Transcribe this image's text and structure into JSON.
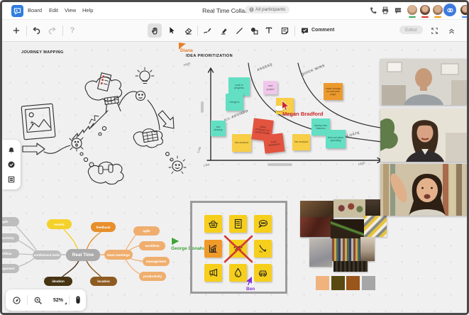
{
  "menubar": {
    "menus": [
      "Board",
      "Edit",
      "View",
      "Help"
    ],
    "title": "Real Time Collaboration",
    "participants_badge": "All participants",
    "action_icons": [
      "phone-icon",
      "printer-icon",
      "chat-icon",
      "invite-link-icon"
    ],
    "avatars": [
      {
        "underline": "#34a853"
      },
      {
        "underline": "#d93025"
      },
      {
        "underline": "#f29900"
      },
      {
        "underline": "#4285f4"
      }
    ]
  },
  "toolbar": {
    "left_tools": [
      "add",
      "undo",
      "redo",
      "help"
    ],
    "center_tools": [
      "hand",
      "select",
      "eraser",
      "pen",
      "highlighter",
      "line",
      "shapes",
      "text",
      "sticky-note",
      "comment"
    ],
    "selected_tool": "hand",
    "comment_label": "Comment",
    "role_badge": "Editor",
    "right_controls": [
      "fullscreen",
      "collapse-toolbar"
    ]
  },
  "canvas": {
    "journey_title": "JOURNEY MAPPING",
    "matrix": {
      "title": "IDEA PRIORITIZATION",
      "regions": {
        "assess": "ASSESS",
        "quick_wins": "QUICK WINS",
        "ill_advised": "ILL-ADVISED",
        "evaluate": "EVALUATE"
      },
      "axes": {
        "x_low": "Low",
        "x_high": "High",
        "y_low": "Low",
        "y_high": "High"
      },
      "notes": [
        {
          "text": "work in progress",
          "color": "#63dfc4"
        },
        {
          "text": "merge in",
          "color": "#63dfc4"
        },
        {
          "text": "new project",
          "color": "#f0c7eb"
        },
        {
          "text": "",
          "color": "#f7ce46"
        },
        {
          "text": "make change on welcome page",
          "color": "#ec9a2e"
        },
        {
          "text": "doc sharing",
          "color": "#63dfc4"
        },
        {
          "text": "risk analysis",
          "color": "#f7ce46"
        },
        {
          "text": "share privileges on social media",
          "color": "#e25440"
        },
        {
          "text": "team integration",
          "color": "#e25440"
        },
        {
          "text": "risk analysis",
          "color": "#f7ce46"
        },
        {
          "text": "deploy new features",
          "color": "#63dfc4"
        },
        {
          "text": "time out when operating",
          "color": "#63dfc4"
        }
      ],
      "edit_tooltip": "···"
    },
    "mindmap": {
      "center": {
        "label": "Real Time",
        "color": "#ababab"
      },
      "nodes": [
        {
          "label": "events",
          "color": "#f5d12b"
        },
        {
          "label": "feedback",
          "color": "#e78f2b"
        },
        {
          "label": "conference tools",
          "color": "#bdbdbd"
        },
        {
          "label": "team meetings",
          "color": "#efae6e"
        },
        {
          "label": "agile",
          "color": "#efae6e"
        },
        {
          "label": "workflow",
          "color": "#efae6e"
        },
        {
          "label": "management",
          "color": "#efae6e"
        },
        {
          "label": "productivity",
          "color": "#efae6e"
        },
        {
          "label": "ideation",
          "color": "#473413"
        },
        {
          "label": "location",
          "color": "#8d5b21"
        }
      ],
      "left_stubs": [
        {
          "label": "agile",
          "color": "#bdbdbd"
        },
        {
          "label": "productivity",
          "color": "#bdbdbd"
        },
        {
          "label": "workflow",
          "color": "#bdbdbd"
        },
        {
          "label": "management",
          "color": "#bdbdbd"
        }
      ]
    },
    "icon_board": {
      "icons": [
        "basket",
        "checklist",
        "chat-bubble",
        "growth-chart",
        "handshake-rejected",
        "declining-chart",
        "megaphone",
        "water-drop",
        "car"
      ],
      "highlight_cell_color": "#ef9a29",
      "cross_color": "#d23b2f"
    },
    "cursors": [
      {
        "name": "Diana",
        "color": "#e87e23"
      },
      {
        "name": "Megan Bradford",
        "color": "#cc2525"
      },
      {
        "name": "George Donahue",
        "color": "#3fa33b"
      },
      {
        "name": "Ben",
        "color": "#7f30d9"
      }
    ],
    "dock_icons": [
      "bell",
      "check-circle",
      "notes-list"
    ],
    "palette_swatches": [
      "#f0b37e",
      "#584a10",
      "#9a551b",
      "#a6a6a6"
    ],
    "zoom_controls": {
      "icons": [
        "locate",
        "zoom-in",
        "mouse"
      ],
      "zoom_level": "52%"
    }
  }
}
